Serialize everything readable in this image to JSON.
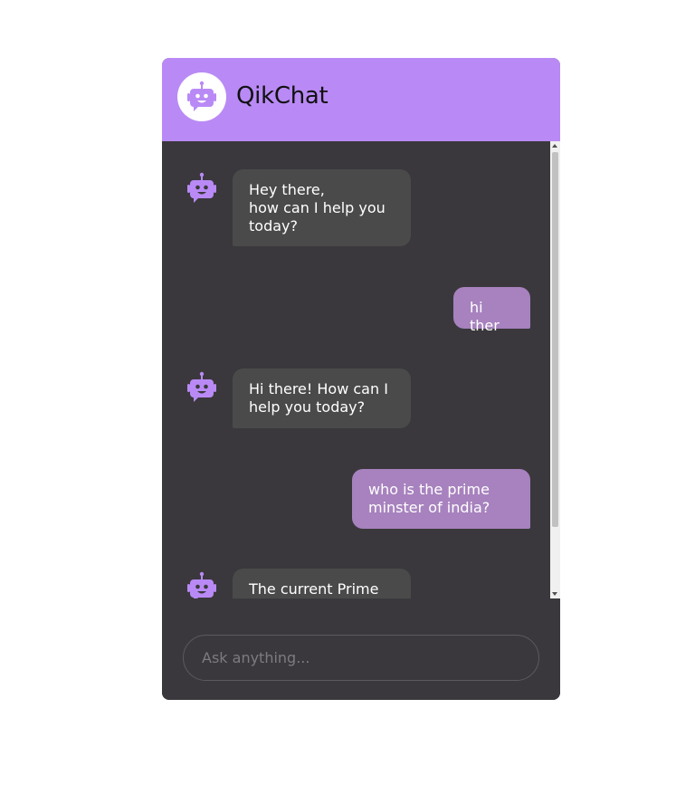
{
  "app": {
    "title": "QikChat",
    "accent_color": "#b98af5",
    "header_icon": "robot-icon"
  },
  "messages": [
    {
      "sender": "bot",
      "text": "Hey there,\nhow can I help you\ntoday?"
    },
    {
      "sender": "user",
      "text": "hi ther"
    },
    {
      "sender": "bot",
      "text": "Hi there! How can I\nhelp you today?"
    },
    {
      "sender": "user",
      "text": "who is the prime\nminster of india?"
    },
    {
      "sender": "bot",
      "text": "The current Prime"
    }
  ],
  "input": {
    "placeholder": "Ask anything...",
    "value": ""
  }
}
